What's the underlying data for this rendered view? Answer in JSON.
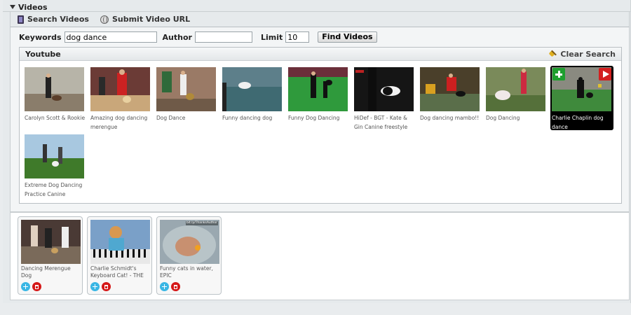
{
  "panel": {
    "title": "Videos"
  },
  "toolbar": {
    "search_label": "Search Videos",
    "submit_label": "Submit Video URL"
  },
  "search": {
    "keywords_label": "Keywords",
    "keywords_value": "dog dance",
    "author_label": "Author",
    "author_value": "",
    "limit_label": "Limit",
    "limit_value": "10",
    "find_button": "Find Videos"
  },
  "results": {
    "source_title": "Youtube",
    "clear_label": "Clear Search",
    "videos": [
      {
        "title": "Carolyn Scott & Rookie"
      },
      {
        "title": "Amazing dog dancing merengue"
      },
      {
        "title": "Dog Dance"
      },
      {
        "title": "Funny dancing dog"
      },
      {
        "title": "Funny Dog Dancing"
      },
      {
        "title": "HiDef - BGT - Kate & Gin Canine freestyle"
      },
      {
        "title": "Dog dancing mambo!!"
      },
      {
        "title": "Dog Dancing"
      },
      {
        "title": "Charlie Chaplin dog dance"
      },
      {
        "title": "Extreme Dog Dancing Practice Canine"
      }
    ]
  },
  "selected": {
    "videos": [
      {
        "title": "Dancing Merengue Dog"
      },
      {
        "title": "Charlie Schmidt's Keyboard Cat! - THE ORIGINAL!"
      },
      {
        "title": "Funny cats in water, EPIC",
        "overlay_text": "bit.ly/ThanksAuthor"
      }
    ]
  }
}
